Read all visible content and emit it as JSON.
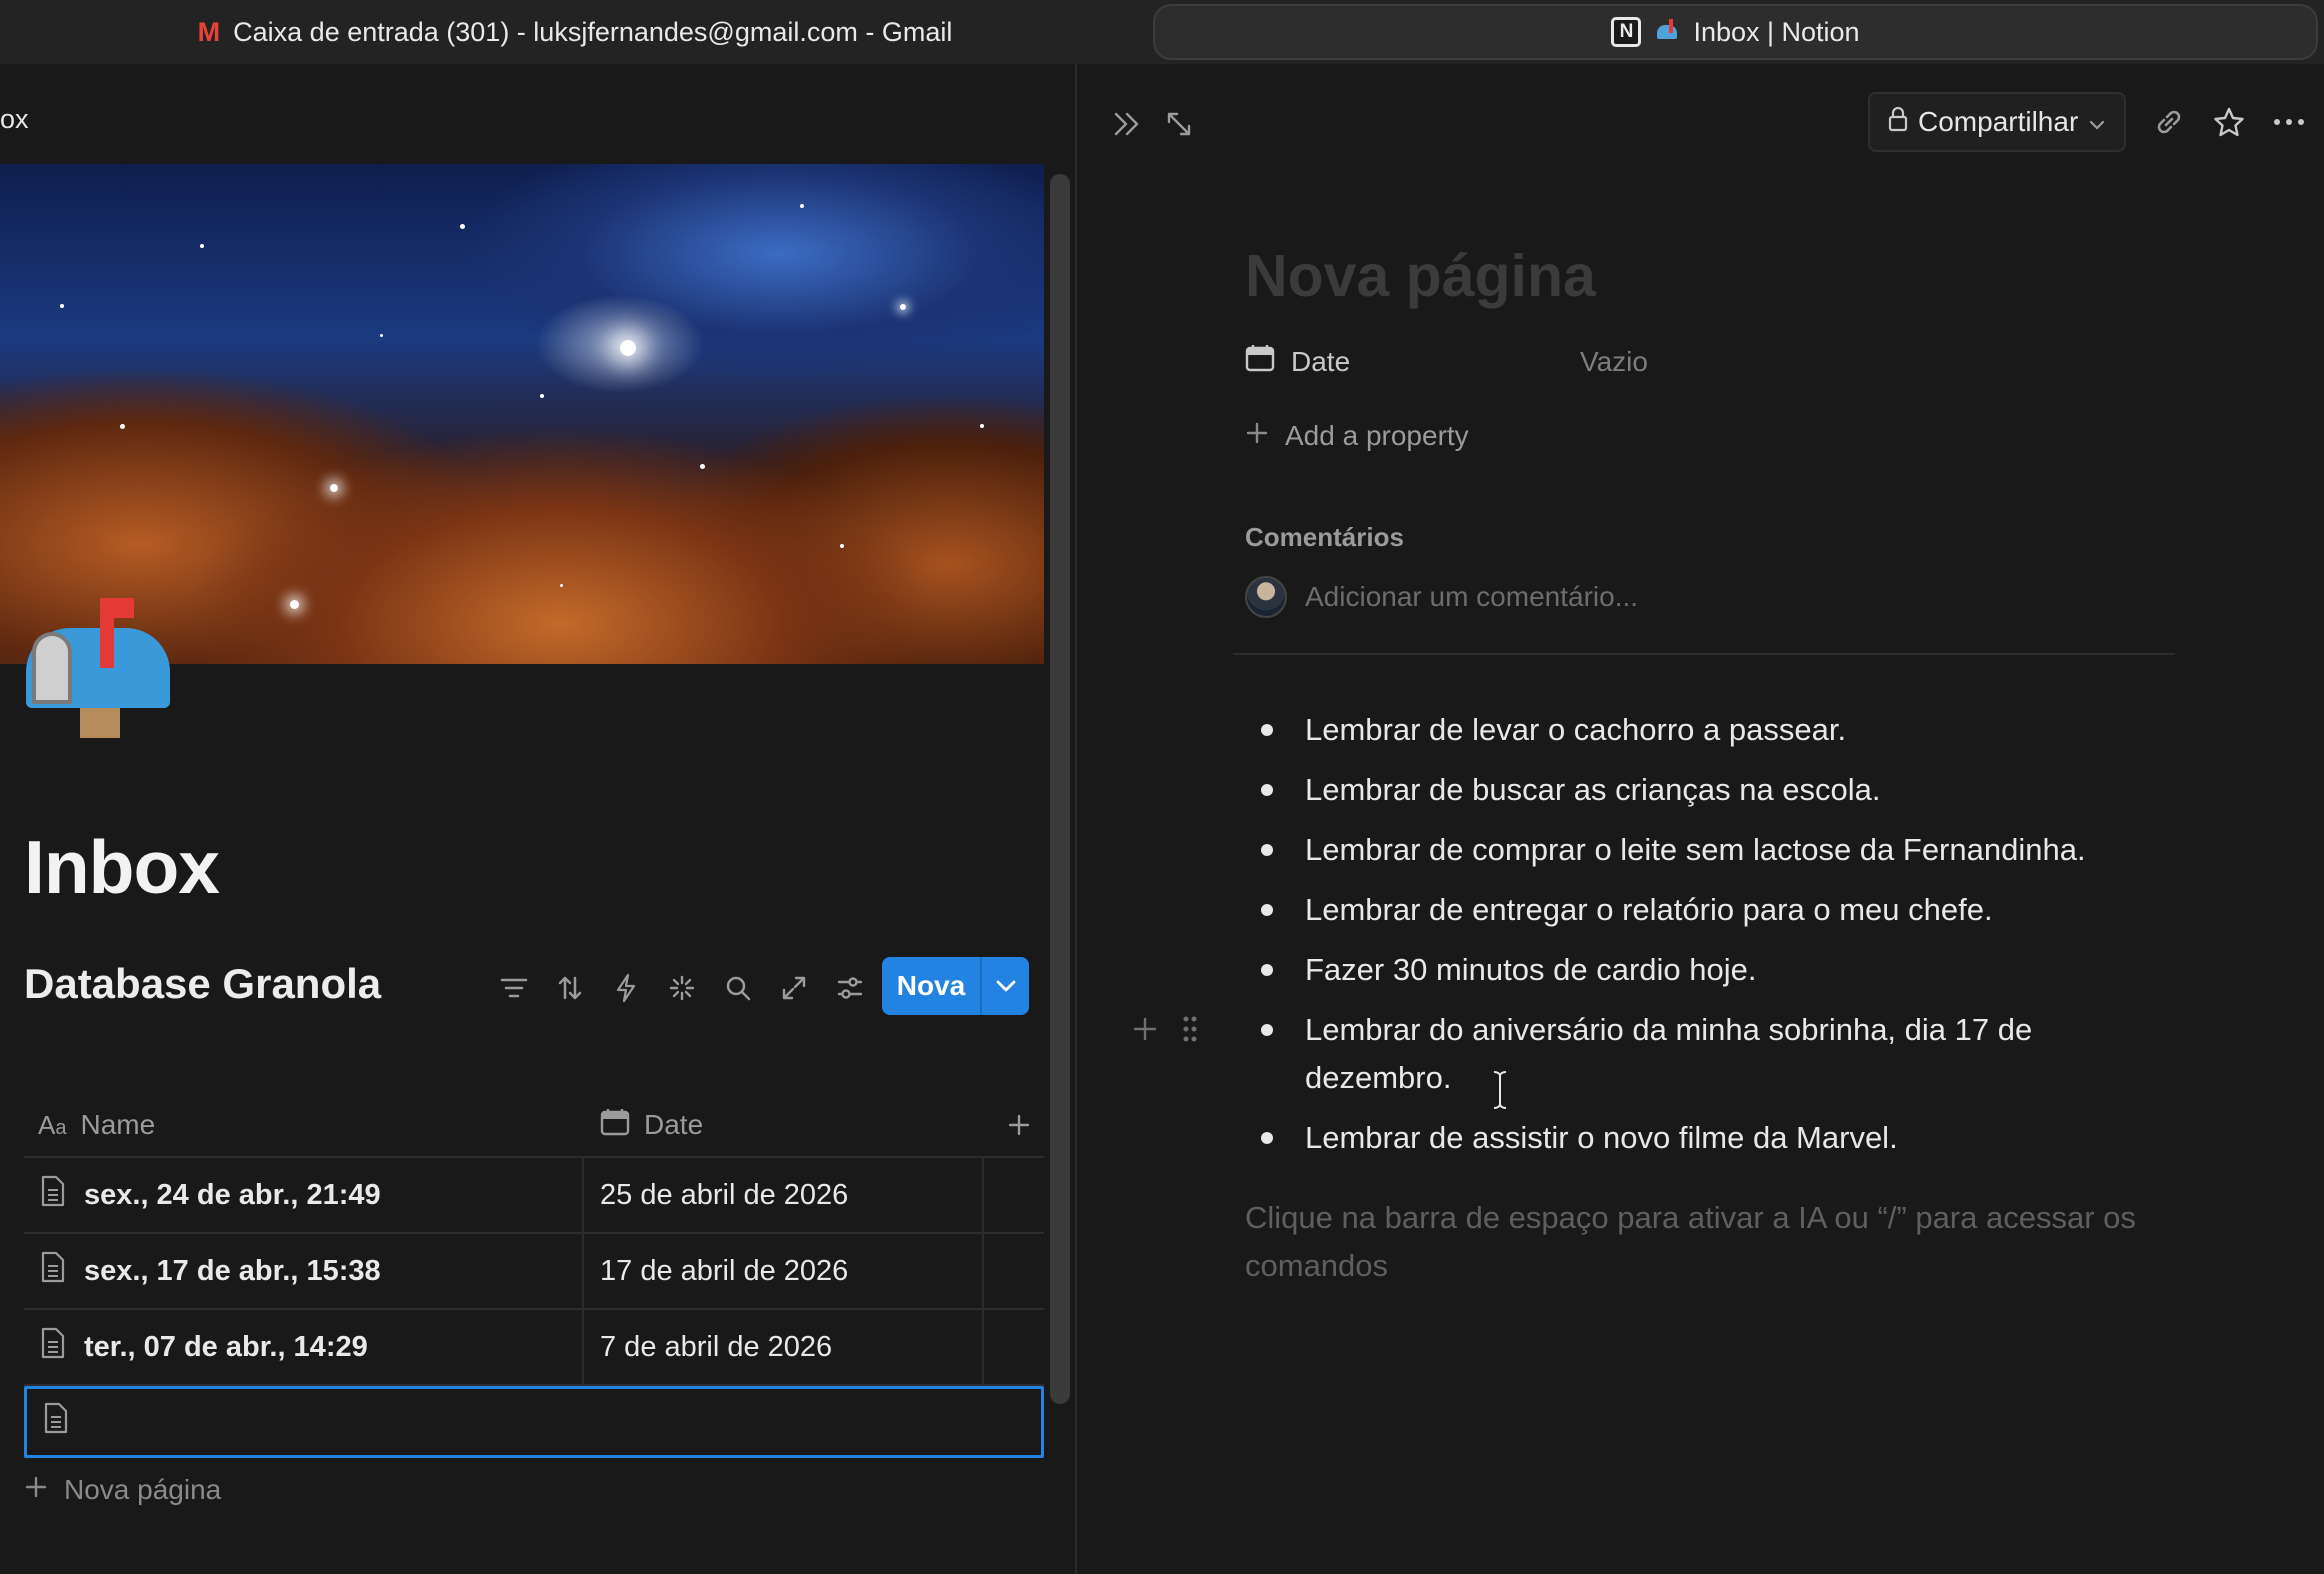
{
  "tabs": {
    "gmail": {
      "title": "Caixa de entrada (301) - luksjfernandes@gmail.com - Gmail",
      "icon": "gmail-icon"
    },
    "notion": {
      "title": "Inbox | Notion",
      "icon": "notion-icon"
    }
  },
  "left": {
    "breadcrumb": "ox",
    "page_title": "Inbox",
    "page_icon": "mailbox-icon",
    "database": {
      "title": "Database Granola",
      "new_button": "Nova",
      "columns": {
        "name": "Name",
        "date": "Date"
      },
      "rows": [
        {
          "name": "sex., 24 de abr., 21:49",
          "date": "25 de abril de 2026"
        },
        {
          "name": "sex., 17 de abr., 15:38",
          "date": "17 de abril de 2026"
        },
        {
          "name": "ter., 07 de abr., 14:29",
          "date": "7 de abril de 2026"
        }
      ],
      "new_page": "Nova página"
    }
  },
  "right": {
    "share_button": "Compartilhar",
    "title_placeholder": "Nova página",
    "properties": {
      "date_label": "Date",
      "date_value": "Vazio",
      "add_property": "Add a property"
    },
    "comments": {
      "heading": "Comentários",
      "placeholder": "Adicionar um comentário..."
    },
    "bullets": [
      "Lembrar de levar o cachorro a passear.",
      "Lembrar de buscar as crianças na escola.",
      "Lembrar de comprar o leite sem lactose da Fernandinha.",
      "Lembrar de entregar o relatório para o meu chefe.",
      "Fazer 30 minutos de cardio hoje.",
      "Lembrar do aniversário da minha sobrinha, dia 17 de dezembro.",
      "Lembrar de assistir o novo filme da Marvel."
    ],
    "empty_block_hint": "Clique na barra de espaço para ativar a IA ou “/” para acessar os comandos"
  },
  "colors": {
    "accent": "#2383e2",
    "background": "#191919",
    "text": "#e6e6e6",
    "muted": "#9b9b9b"
  }
}
